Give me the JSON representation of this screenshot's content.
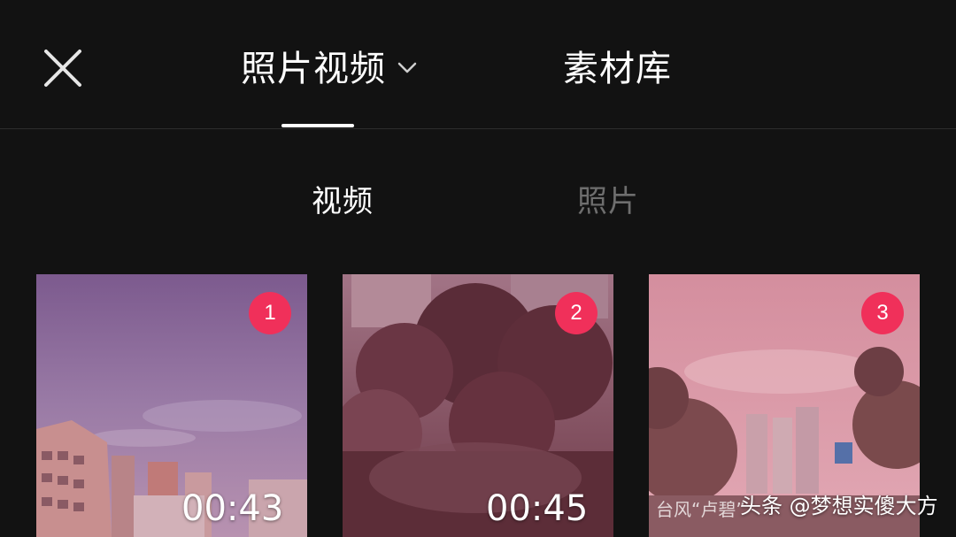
{
  "header": {
    "tabs": [
      {
        "label": "照片视频",
        "active": true,
        "has_dropdown": true
      },
      {
        "label": "素材库",
        "active": false
      }
    ],
    "close_icon": "close-icon"
  },
  "subtabs": [
    {
      "label": "视频",
      "active": true
    },
    {
      "label": "照片",
      "active": false
    }
  ],
  "media": [
    {
      "badge": "1",
      "duration": "00:43"
    },
    {
      "badge": "2",
      "duration": "00:45"
    },
    {
      "badge": "3",
      "caption": "台风“卢碧”"
    }
  ],
  "watermark": "头条 @梦想实傻大方",
  "colors": {
    "background": "#121212",
    "badge": "#f0305a",
    "inactive_text": "#6e6e6e",
    "active_text": "#ffffff"
  }
}
